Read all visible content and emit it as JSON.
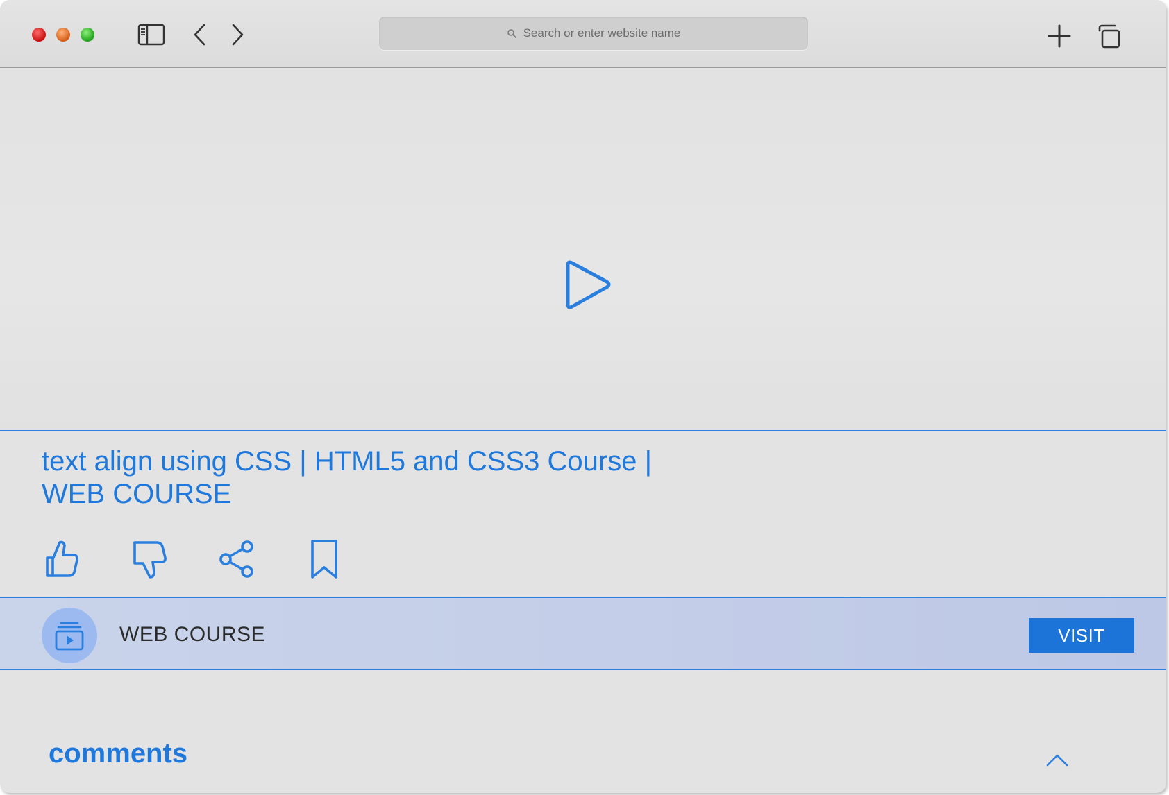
{
  "browser": {
    "address_bar": {
      "placeholder": "Search or enter website name"
    },
    "icons": [
      "sidebar-icon",
      "back-icon",
      "forward-icon",
      "search-icon",
      "plus-icon",
      "tabs-icon"
    ]
  },
  "video": {
    "title": "text align using CSS | HTML5 and CSS3 Course | WEB COURSE",
    "play_icon": "play-icon"
  },
  "actions": [
    {
      "name": "like",
      "icon": "thumbs-up-icon"
    },
    {
      "name": "dislike",
      "icon": "thumbs-down-icon"
    },
    {
      "name": "share",
      "icon": "share-icon"
    },
    {
      "name": "save",
      "icon": "bookmark-icon"
    }
  ],
  "channel": {
    "name": "WEB COURSE",
    "visit_label": "VISIT",
    "avatar_icon": "playlist-icon"
  },
  "comments": {
    "title": "comments",
    "toggle_icon": "chevron-up-icon"
  },
  "colors": {
    "accent": "#1f78dc",
    "visit_button": "#1c74d8",
    "channel_bar": "#c3cde8",
    "background": "#e3e3e3"
  }
}
